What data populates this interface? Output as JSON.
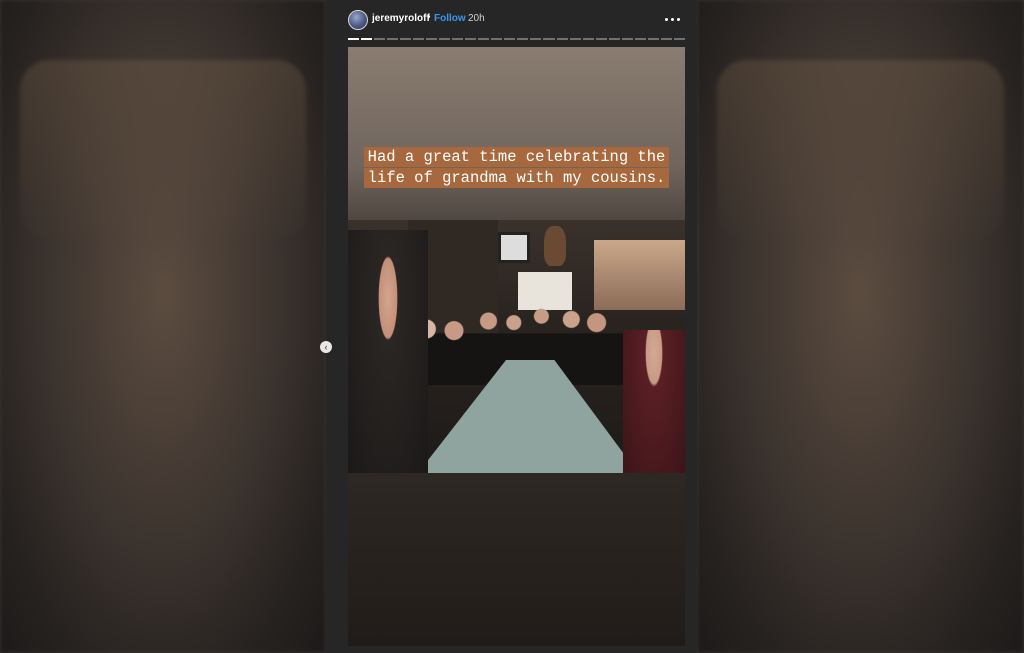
{
  "header": {
    "username": "jeremyroloff",
    "separator": "•",
    "follow_label": "Follow",
    "time": "20h",
    "more_icon": "more-dots-icon"
  },
  "story": {
    "caption": "Had a great time celebrating the life of grandma with my cousins.",
    "caption_bg": "#a8683d",
    "progress_total": 26,
    "progress_current": 2
  },
  "nav": {
    "prev_glyph": "‹"
  }
}
